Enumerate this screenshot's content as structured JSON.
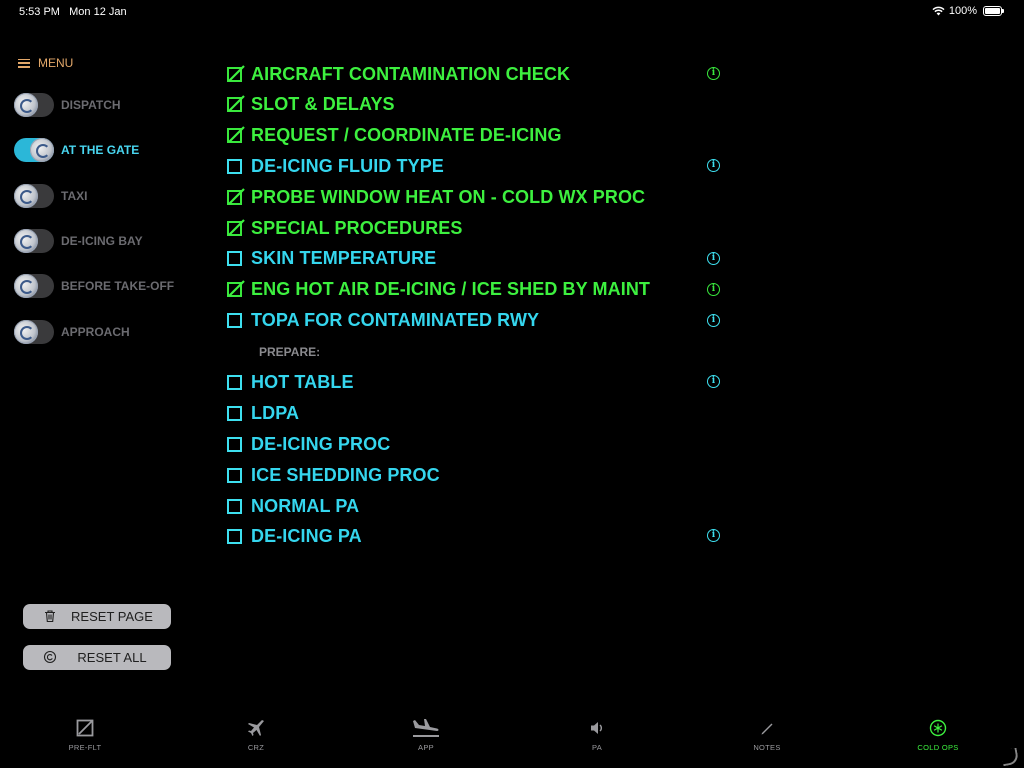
{
  "status_bar": {
    "time": "5:53 PM",
    "date": "Mon 12 Jan",
    "battery": "100%"
  },
  "menu": {
    "label": "MENU"
  },
  "phases": [
    {
      "label": "DISPATCH",
      "active": false
    },
    {
      "label": "AT THE GATE",
      "active": true
    },
    {
      "label": "TAXI",
      "active": false
    },
    {
      "label": "DE-ICING BAY",
      "active": false
    },
    {
      "label": "BEFORE TAKE-OFF",
      "active": false
    },
    {
      "label": "APPROACH",
      "active": false
    }
  ],
  "buttons": {
    "reset_page": "RESET PAGE",
    "reset_all": "RESET ALL"
  },
  "checklist": [
    {
      "label": "AIRCRAFT CONTAMINATION CHECK",
      "checked": true,
      "info": true
    },
    {
      "label": "SLOT & DELAYS",
      "checked": true,
      "info": false
    },
    {
      "label": "REQUEST / COORDINATE DE-ICING",
      "checked": true,
      "info": false
    },
    {
      "label": "DE-ICING FLUID TYPE",
      "checked": false,
      "info": true
    },
    {
      "label": "PROBE WINDOW HEAT ON - COLD WX PROC",
      "checked": true,
      "info": false
    },
    {
      "label": "SPECIAL PROCEDURES",
      "checked": true,
      "info": false
    },
    {
      "label": "SKIN TEMPERATURE",
      "checked": false,
      "info": true
    },
    {
      "label": "ENG HOT AIR DE-ICING / ICE SHED BY MAINT",
      "checked": true,
      "info": true
    },
    {
      "label": "TOPA FOR CONTAMINATED RWY",
      "checked": false,
      "info": true
    }
  ],
  "prepare_section": {
    "heading": "PREPARE:"
  },
  "prepare_items": [
    {
      "label": "HOT TABLE",
      "checked": false,
      "info": true
    },
    {
      "label": "LDPA",
      "checked": false,
      "info": false
    },
    {
      "label": "DE-ICING PROC",
      "checked": false,
      "info": false
    },
    {
      "label": "ICE SHEDDING PROC",
      "checked": false,
      "info": false
    },
    {
      "label": "NORMAL PA",
      "checked": false,
      "info": false
    },
    {
      "label": "DE-ICING PA",
      "checked": false,
      "info": true
    }
  ],
  "tabs": [
    {
      "label": "PRE-FLT",
      "icon": "checkbox-icon",
      "active": false
    },
    {
      "label": "CRZ",
      "icon": "airplane-icon",
      "active": false
    },
    {
      "label": "APP",
      "icon": "landing-icon",
      "active": false
    },
    {
      "label": "PA",
      "icon": "speaker-icon",
      "active": false
    },
    {
      "label": "NOTES",
      "icon": "pencil-icon",
      "active": false
    },
    {
      "label": "COLD OPS",
      "icon": "snowflake-icon",
      "active": true
    }
  ],
  "colors": {
    "done": "#3df03f",
    "pending": "#35d6ee",
    "menu": "#e3a86a",
    "toggle_on": "#2bb7d8"
  }
}
